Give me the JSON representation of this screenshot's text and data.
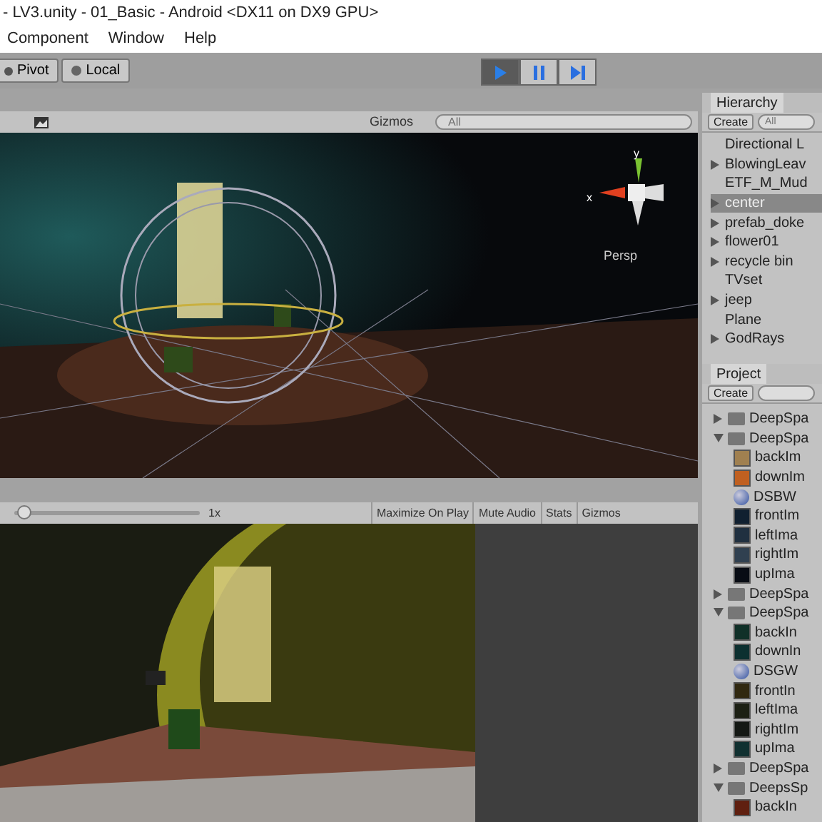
{
  "window": {
    "title": "- LV3.unity - 01_Basic - Android <DX11 on DX9 GPU>"
  },
  "menu": [
    {
      "label": "Component"
    },
    {
      "label": "Window"
    },
    {
      "label": "Help"
    }
  ],
  "toolbar": {
    "pivot": "Pivot",
    "space": "Local",
    "play_buttons": [
      {
        "kind": "play",
        "selected": true
      },
      {
        "kind": "pause",
        "selected": false
      },
      {
        "kind": "step",
        "selected": false
      }
    ]
  },
  "scene": {
    "gizmos": "Gizmos",
    "search_placeholder": "All",
    "axis_y": "y",
    "axis_x": "x",
    "projection": "Persp"
  },
  "game": {
    "scale_label": "1x",
    "scale": {
      "level": 0.02
    },
    "buttons": [
      {
        "label": "Maximize On Play"
      },
      {
        "label": "Mute Audio"
      },
      {
        "label": "Stats"
      },
      {
        "label": "Gizmos"
      }
    ]
  },
  "hierarchy": {
    "title": "Hierarchy",
    "create": "Create",
    "search_placeholder": "All",
    "items": [
      {
        "label": "Directional L",
        "expandable": false,
        "selected": false
      },
      {
        "label": "BlowingLeav",
        "expandable": true,
        "selected": false
      },
      {
        "label": "ETF_M_Mud",
        "expandable": false,
        "selected": false
      },
      {
        "label": "center",
        "expandable": true,
        "selected": true
      },
      {
        "label": "prefab_doke",
        "expandable": true,
        "selected": false
      },
      {
        "label": "flower01",
        "expandable": true,
        "selected": false
      },
      {
        "label": "recycle bin",
        "expandable": true,
        "selected": false
      },
      {
        "label": "TVset",
        "expandable": false,
        "selected": false
      },
      {
        "label": "jeep",
        "expandable": true,
        "selected": false
      },
      {
        "label": "Plane",
        "expandable": false,
        "selected": false
      },
      {
        "label": "GodRays",
        "expandable": true,
        "selected": false
      }
    ]
  },
  "project": {
    "title": "Project",
    "create": "Create",
    "items": [
      {
        "label": "DeepSpa",
        "kind": "folder",
        "expanded": false
      },
      {
        "label": "DeepSpa",
        "kind": "folder",
        "expanded": true,
        "children": [
          {
            "label": "backIm",
            "kind": "texture",
            "color": "#a08050"
          },
          {
            "label": "downIm",
            "kind": "texture",
            "color": "#c06020"
          },
          {
            "label": "DSBW",
            "kind": "material"
          },
          {
            "label": "frontIm",
            "kind": "texture",
            "color": "#102030"
          },
          {
            "label": "leftIma",
            "kind": "texture",
            "color": "#203040"
          },
          {
            "label": "rightIm",
            "kind": "texture",
            "color": "#304050"
          },
          {
            "label": "upIma",
            "kind": "texture",
            "color": "#080c14"
          }
        ]
      },
      {
        "label": "DeepSpa",
        "kind": "folder",
        "expanded": false
      },
      {
        "label": "DeepSpa",
        "kind": "folder",
        "expanded": true,
        "children": [
          {
            "label": "backIn",
            "kind": "texture",
            "color": "#103028"
          },
          {
            "label": "downIn",
            "kind": "texture",
            "color": "#0c3030"
          },
          {
            "label": "DSGW",
            "kind": "material"
          },
          {
            "label": "frontIn",
            "kind": "texture",
            "color": "#302810"
          },
          {
            "label": "leftIma",
            "kind": "texture",
            "color": "#1c2014"
          },
          {
            "label": "rightIm",
            "kind": "texture",
            "color": "#141814"
          },
          {
            "label": "upIma",
            "kind": "texture",
            "color": "#103030"
          }
        ]
      },
      {
        "label": "DeepSpa",
        "kind": "folder",
        "expanded": false
      },
      {
        "label": "DeepsSp",
        "kind": "folder",
        "expanded": true,
        "children": [
          {
            "label": "backIn",
            "kind": "texture",
            "color": "#602010"
          }
        ]
      }
    ]
  }
}
